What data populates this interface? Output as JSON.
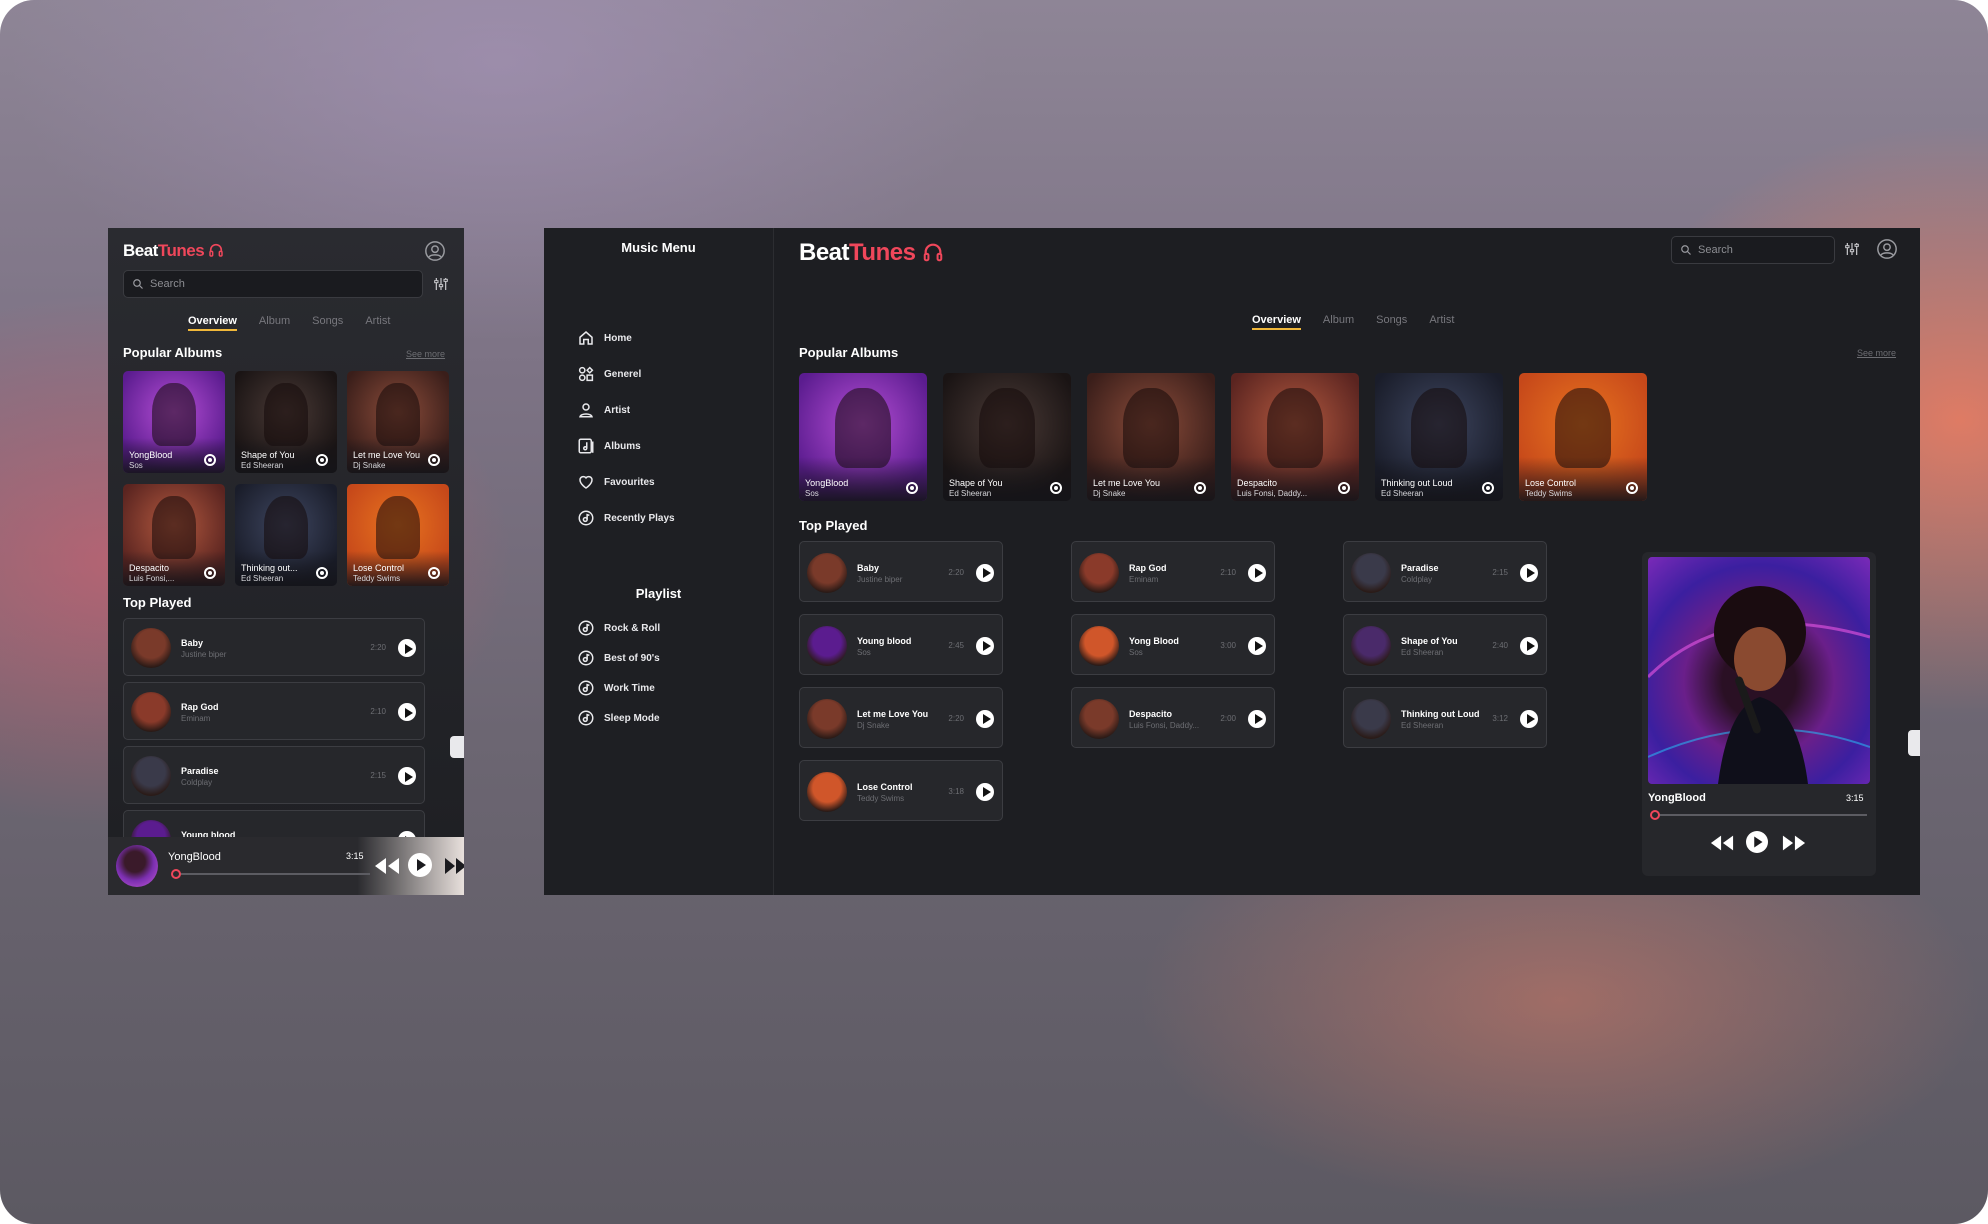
{
  "brand": {
    "part1": "Beat",
    "part2": "Tunes",
    "accent": "#f0475b"
  },
  "search": {
    "placeholder": "Search"
  },
  "tabs": [
    "Overview",
    "Album",
    "Songs",
    "Artist"
  ],
  "sections": {
    "popular": "Popular Albums",
    "see_more": "See more",
    "top_played": "Top Played"
  },
  "sidebar": {
    "title": "Music Menu",
    "items": [
      {
        "label": "Home",
        "icon": "home-icon"
      },
      {
        "label": "Generel",
        "icon": "genre-icon"
      },
      {
        "label": "Artist",
        "icon": "user-icon"
      },
      {
        "label": "Albums",
        "icon": "album-icon"
      },
      {
        "label": "Favourites",
        "icon": "heart-icon"
      },
      {
        "label": "Recently Plays",
        "icon": "disc-icon"
      }
    ],
    "playlist_title": "Playlist",
    "playlists": [
      "Rock & Roll",
      "Best of 90's",
      "Work Time",
      "Sleep Mode"
    ]
  },
  "albums": [
    {
      "title": "YongBlood",
      "artist": "Sos",
      "colors": [
        "#5b1c8f",
        "#b64fd6"
      ]
    },
    {
      "title": "Shape of You",
      "artist": "Ed Sheeran",
      "colors": [
        "#1a1414",
        "#4a3a36"
      ]
    },
    {
      "title": "Let me Love You",
      "artist": "Dj Snake",
      "colors": [
        "#3a1e1a",
        "#8b4c3a"
      ]
    },
    {
      "title": "Despacito",
      "artist": "Luis Fonsi, Daddy...",
      "colors": [
        "#5a2420",
        "#b3593f"
      ]
    },
    {
      "title": "Thinking out Loud",
      "artist": "Ed Sheeran",
      "colors": [
        "#1a1d2a",
        "#3e4660"
      ]
    },
    {
      "title": "Lose Control",
      "artist": "Teddy Swims",
      "colors": [
        "#c6481a",
        "#e8731f"
      ]
    }
  ],
  "mobile_albums": [
    {
      "title": "YongBlood",
      "artist": "Sos"
    },
    {
      "title": "Shape of You",
      "artist": "Ed Sheeran"
    },
    {
      "title": "Let me Love You",
      "artist": "Dj Snake"
    },
    {
      "title": "Despacito",
      "artist": "Luis Fonsi,..."
    },
    {
      "title": "Thinking out...",
      "artist": "Ed Sheeran"
    },
    {
      "title": "Lose Control",
      "artist": "Teddy Swims"
    }
  ],
  "tracks": [
    {
      "name": "Baby",
      "artist": "Justine biper",
      "dur": "2:20",
      "c": "#7a3a2a"
    },
    {
      "name": "Rap God",
      "artist": "Eminam",
      "dur": "2:10",
      "c": "#8a3a2a"
    },
    {
      "name": "Paradise",
      "artist": "Coldplay",
      "dur": "2:15",
      "c": "#3a3a4a"
    },
    {
      "name": "Young blood",
      "artist": "Sos",
      "dur": "2:45",
      "c": "#5b1c8f"
    },
    {
      "name": "Yong Blood",
      "artist": "Sos",
      "dur": "3:00",
      "c": "#d0562a"
    },
    {
      "name": "Shape of You",
      "artist": "Ed Sheeran",
      "dur": "2:40",
      "c": "#4a2a6a"
    },
    {
      "name": "Let me Love You",
      "artist": "Dj Snake",
      "dur": "2:20",
      "c": "#7a3a2a"
    },
    {
      "name": "Despacito",
      "artist": "Luis Fonsi, Daddy...",
      "dur": "2:00",
      "c": "#7a3a2a"
    },
    {
      "name": "Thinking out Loud",
      "artist": "Ed Sheeran",
      "dur": "3:12",
      "c": "#3a3a4a"
    },
    {
      "name": "Lose Control",
      "artist": "Teddy Swims",
      "dur": "3:18",
      "c": "#d0562a"
    }
  ],
  "mobile_tracks": [
    {
      "name": "Baby",
      "artist": "Justine biper",
      "dur": "2:20"
    },
    {
      "name": "Rap God",
      "artist": "Eminam",
      "dur": "2:10"
    },
    {
      "name": "Paradise",
      "artist": "Coldplay",
      "dur": "2:15"
    },
    {
      "name": "Young blood",
      "artist": "",
      "dur": ""
    }
  ],
  "player": {
    "title": "YongBlood",
    "time": "3:15",
    "progress": 0.02
  }
}
